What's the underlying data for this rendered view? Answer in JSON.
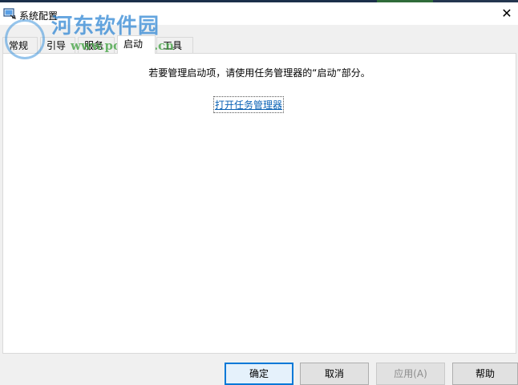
{
  "window": {
    "title": "系统配置",
    "close_glyph": "✕",
    "icon": "msconfig-icon"
  },
  "watermark": {
    "line1": "河东软件园",
    "line2": "www.pc0359.cn"
  },
  "tabs": [
    {
      "label": "常规",
      "active": false
    },
    {
      "label": "引导",
      "active": false
    },
    {
      "label": "服务",
      "active": false
    },
    {
      "label": "启动",
      "active": true
    },
    {
      "label": "工具",
      "active": false
    }
  ],
  "startup": {
    "message": "若要管理启动项，请使用任务管理器的“启动”部分。",
    "link": "打开任务管理器"
  },
  "buttons": {
    "ok": "确定",
    "cancel": "取消",
    "apply": "应用(A)",
    "help": "帮助"
  },
  "colors": {
    "link": "#0b62b5",
    "focus": "#0078d7",
    "watermark_blue": "#2882d2",
    "watermark_green": "#3ca03c"
  }
}
